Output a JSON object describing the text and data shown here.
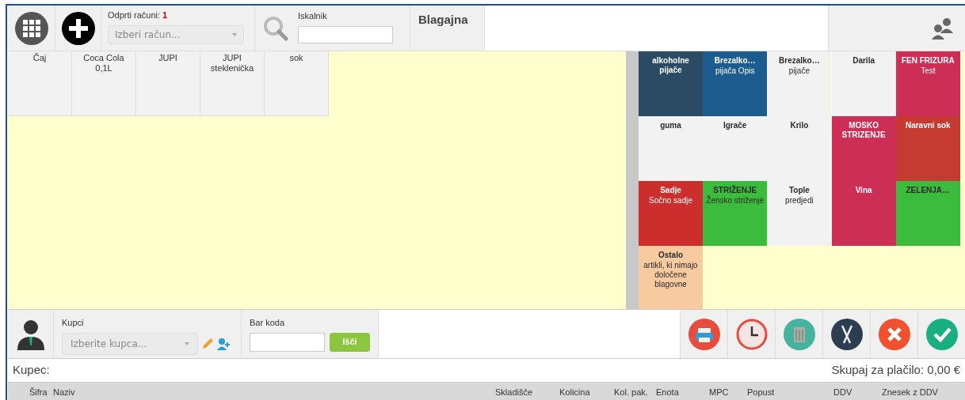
{
  "topbar": {
    "open_bills_label": "Odprti računi:",
    "open_bills_count": "1",
    "bill_select_placeholder": "Izberi račun...",
    "search_label": "Iskalnik",
    "title": "Blagajna"
  },
  "products": [
    {
      "name": "Čaj"
    },
    {
      "name": "Coca Cola",
      "desc": "0,1L"
    },
    {
      "name": "JUPI"
    },
    {
      "name": "JUPI steklenička"
    },
    {
      "name": "sok"
    }
  ],
  "categories": [
    {
      "name": "alkoholne pijače",
      "color": "#2b4a63",
      "light_text": true
    },
    {
      "name": "Brezalko…",
      "desc": "pijača Opis",
      "color": "#1d5c8e",
      "light_text": true
    },
    {
      "name": "Brezalko…",
      "desc": "pijače",
      "color": "#f2f2f2",
      "light_text": false
    },
    {
      "name": "Darila",
      "color": "#f2f2f2",
      "light_text": false
    },
    {
      "name": "FEN FRIZURA",
      "desc": "Test",
      "color": "#cc2e55",
      "light_text": true
    },
    {
      "name": "guma",
      "color": "#f2f2f2",
      "light_text": false
    },
    {
      "name": "Igrače",
      "color": "#f2f2f2",
      "light_text": false
    },
    {
      "name": "Krilo",
      "color": "#f2f2f2",
      "light_text": false
    },
    {
      "name": "MOSKO STRIZENJE",
      "color": "#cc2e55",
      "light_text": true
    },
    {
      "name": "Naravni sok",
      "color": "#c63b31",
      "light_text": true
    },
    {
      "name": "Sadje",
      "desc": "Sočno sadje",
      "color": "#cc2d2d",
      "light_text": true
    },
    {
      "name": "STRIŽENJE",
      "desc": "Žensko striženje",
      "color": "#3cbc3c",
      "light_text": false
    },
    {
      "name": "Tople",
      "desc": "predjedi",
      "color": "#f2f2f2",
      "light_text": false
    },
    {
      "name": "Vina",
      "color": "#cc2e55",
      "light_text": true
    },
    {
      "name": "ZELENJA…",
      "color": "#3cbc3c",
      "light_text": false
    },
    {
      "name": "Ostalo",
      "desc": "artikli, ki nimajo določene blagovne",
      "color": "#f8caa0",
      "light_text": false
    }
  ],
  "bottombar": {
    "customers_label": "Kupci",
    "customer_placeholder": "Izberite kupca...",
    "barcode_label": "Bar koda",
    "barcode_button": "Išči",
    "actions": [
      {
        "kind": "print"
      },
      {
        "kind": "clock"
      },
      {
        "kind": "trash"
      },
      {
        "kind": "cutlery"
      },
      {
        "kind": "cancel"
      },
      {
        "kind": "confirm"
      }
    ]
  },
  "summary": {
    "customer_label": "Kupec:",
    "total": "Skupaj za plačilo: 0,00 €"
  },
  "table": {
    "columns": [
      "Šifra",
      "Naziv",
      "Skladišče",
      "Kolicina",
      "Kol. pak.",
      "Enota",
      "MPC",
      "Popust",
      "DDV",
      "Znesek z DDV"
    ]
  }
}
